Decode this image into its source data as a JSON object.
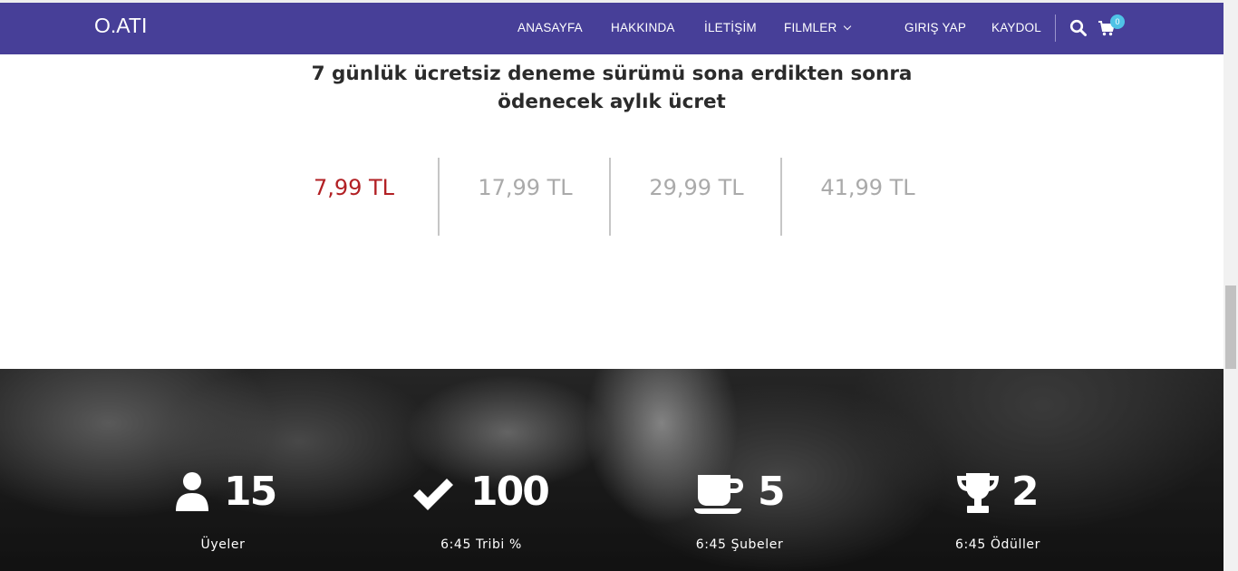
{
  "brand": {
    "logo": "O.ATI"
  },
  "nav": {
    "links": [
      "ANASAYFA",
      "HAKKINDA",
      "İLETİŞİM",
      "FILMLER"
    ],
    "login": "GIRIŞ YAP",
    "register": "KAYDOL",
    "cart_count": "0"
  },
  "pricing": {
    "heading_line1": "7 günlük ücretsiz deneme sürümü sona erdikten sonra",
    "heading_line2": "ödenecek aylık ücret",
    "prices": [
      "7,99 TL",
      "17,99 TL",
      "29,99 TL",
      "41,99 TL"
    ],
    "active_color": "#b22024"
  },
  "stats": [
    {
      "icon": "user-icon",
      "value": "15",
      "label": "Üyeler"
    },
    {
      "icon": "check-icon",
      "value": "100",
      "label": "6:45 Tribi %"
    },
    {
      "icon": "coffee-icon",
      "value": "5",
      "label": "6:45 Şubeler"
    },
    {
      "icon": "trophy-icon",
      "value": "2",
      "label": "6:45 Ödüller"
    }
  ],
  "colors": {
    "navbar": "#473f98",
    "badge": "#4fc3e6"
  }
}
